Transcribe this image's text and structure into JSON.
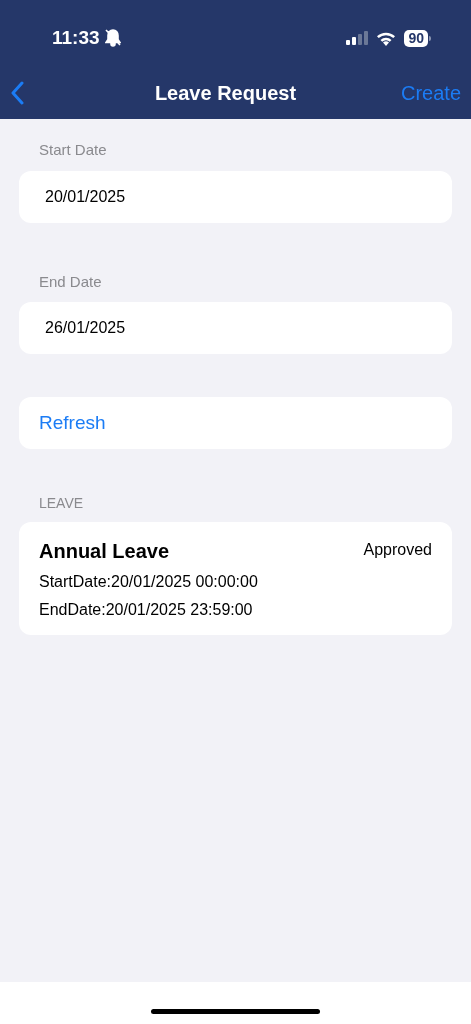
{
  "status_bar": {
    "time": "11:33",
    "battery": "90"
  },
  "nav": {
    "title": "Leave Request",
    "action": "Create"
  },
  "fields": [
    {
      "label": "Start Date",
      "value": "20/01/2025"
    },
    {
      "label": "End Date",
      "value": "26/01/2025"
    }
  ],
  "refresh_button": "Refresh",
  "section": {
    "header": "LEAVE",
    "items": [
      {
        "type": "Annual Leave",
        "status": "Approved",
        "start": "StartDate:20/01/2025 00:00:00",
        "end": "EndDate:20/01/2025 23:59:00"
      }
    ]
  }
}
